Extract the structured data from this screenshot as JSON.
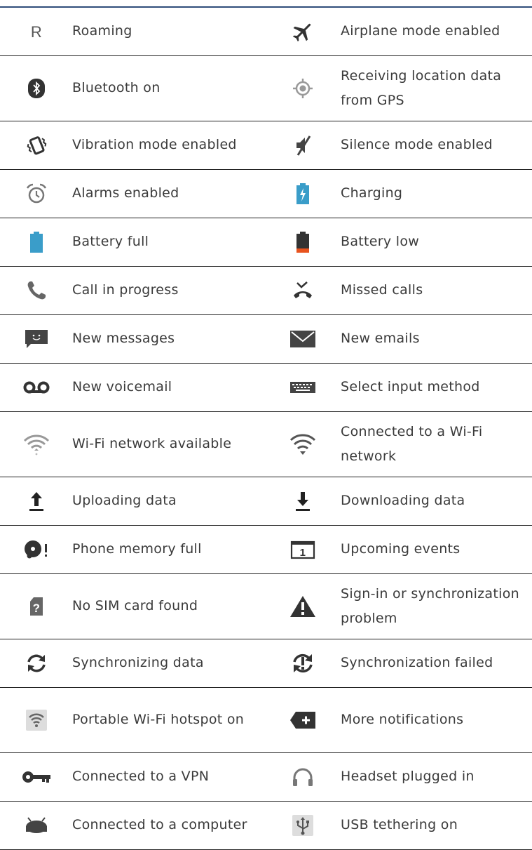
{
  "rows": [
    {
      "left": {
        "icon": "roaming-icon",
        "text": "Roaming"
      },
      "right": {
        "icon": "airplane-icon",
        "text": "Airplane mode enabled"
      }
    },
    {
      "left": {
        "icon": "bluetooth-icon",
        "text": "Bluetooth on"
      },
      "right": {
        "icon": "gps-icon",
        "text": "Receiving location data from GPS"
      }
    },
    {
      "left": {
        "icon": "vibration-icon",
        "text": "Vibration mode enabled"
      },
      "right": {
        "icon": "silence-icon",
        "text": "Silence mode enabled"
      }
    },
    {
      "left": {
        "icon": "alarm-icon",
        "text": "Alarms enabled"
      },
      "right": {
        "icon": "charging-icon",
        "text": "Charging"
      }
    },
    {
      "left": {
        "icon": "battery-full-icon",
        "text": "Battery full"
      },
      "right": {
        "icon": "battery-low-icon",
        "text": "Battery low"
      }
    },
    {
      "left": {
        "icon": "call-icon",
        "text": "Call in progress"
      },
      "right": {
        "icon": "missed-call-icon",
        "text": "Missed calls"
      }
    },
    {
      "left": {
        "icon": "message-icon",
        "text": "New messages"
      },
      "right": {
        "icon": "email-icon",
        "text": "New emails"
      }
    },
    {
      "left": {
        "icon": "voicemail-icon",
        "text": "New voicemail"
      },
      "right": {
        "icon": "keyboard-icon",
        "text": "Select input method"
      }
    },
    {
      "left": {
        "icon": "wifi-available-icon",
        "text": "Wi-Fi network available"
      },
      "right": {
        "icon": "wifi-connected-icon",
        "text": "Connected to a Wi-Fi network"
      }
    },
    {
      "left": {
        "icon": "upload-icon",
        "text": "Uploading data"
      },
      "right": {
        "icon": "download-icon",
        "text": "Downloading data"
      }
    },
    {
      "left": {
        "icon": "memory-full-icon",
        "text": "Phone memory full"
      },
      "right": {
        "icon": "calendar-icon",
        "text": "Upcoming events"
      }
    },
    {
      "left": {
        "icon": "no-sim-icon",
        "text": "No SIM card found"
      },
      "right": {
        "icon": "warning-icon",
        "text": "Sign-in or synchronization problem"
      }
    },
    {
      "left": {
        "icon": "sync-icon",
        "text": "Synchronizing data"
      },
      "right": {
        "icon": "sync-failed-icon",
        "text": "Synchronization failed"
      }
    },
    {
      "left": {
        "icon": "hotspot-icon",
        "text": "Portable Wi-Fi hotspot on"
      },
      "right": {
        "icon": "more-notifications-icon",
        "text": "More notifications"
      }
    },
    {
      "left": {
        "icon": "vpn-key-icon",
        "text": "Connected to a VPN"
      },
      "right": {
        "icon": "headset-icon",
        "text": "Headset plugged in"
      }
    },
    {
      "left": {
        "icon": "computer-icon",
        "text": "Connected to a computer"
      },
      "right": {
        "icon": "usb-icon",
        "text": "USB tethering on"
      }
    }
  ],
  "colors": {
    "icon_gray": "#5a5a5a",
    "light_gray": "#9a9a9a",
    "battery_blue": "#3a9dc9",
    "battery_low_red": "#e8531e",
    "top_rule": "#2f4d7a",
    "text": "#3a3a3a"
  }
}
